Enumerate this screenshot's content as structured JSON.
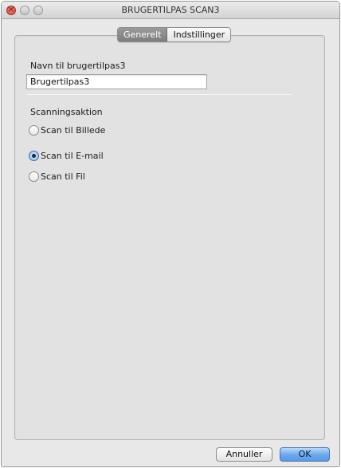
{
  "window": {
    "title": "BRUGERTILPAS SCAN3"
  },
  "tabs": [
    {
      "label": "Generelt",
      "active": true
    },
    {
      "label": "Indstillinger",
      "active": false
    }
  ],
  "name_field": {
    "label": "Navn til brugertilpas3",
    "value": "Brugertilpas3"
  },
  "scan_action": {
    "label": "Scanningsaktion",
    "options": [
      {
        "label": "Scan til Billede",
        "selected": false
      },
      {
        "label": "Scan til E-mail",
        "selected": true
      },
      {
        "label": "Scan til Fil",
        "selected": false
      }
    ]
  },
  "buttons": {
    "cancel_label": "Annuller",
    "ok_label": "OK"
  },
  "colors": {
    "window_bg": "#e8e8e8",
    "accent": "#6aa7ea",
    "close_button": "#d0453c"
  }
}
